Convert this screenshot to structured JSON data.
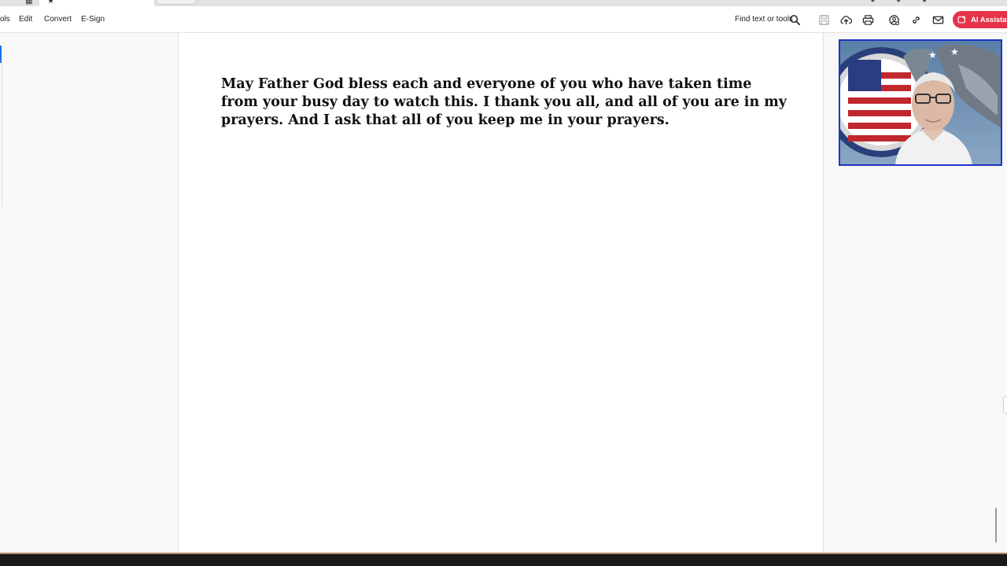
{
  "toolbar": {
    "menu": {
      "tools_partial": "ols",
      "edit": "Edit",
      "convert": "Convert",
      "esign": "E-Sign"
    },
    "find_label": "Find text or tools",
    "icons": [
      "search-icon",
      "save-icon",
      "upload-icon",
      "print-icon",
      "share-icon",
      "link-icon",
      "email-icon"
    ],
    "ai_assistant_label": "AI Assistant"
  },
  "document": {
    "text": "May Father God bless each and everyone of you who have taken time from your busy day to watch this. I thank you all, and all of you are in my prayers. And I ask that all of you keep me in your prayers."
  },
  "colors": {
    "ai_button": "#e4344a",
    "webcam_border": "#1e35c8",
    "page": "#ffffff",
    "chrome": "#f8f8f8"
  }
}
